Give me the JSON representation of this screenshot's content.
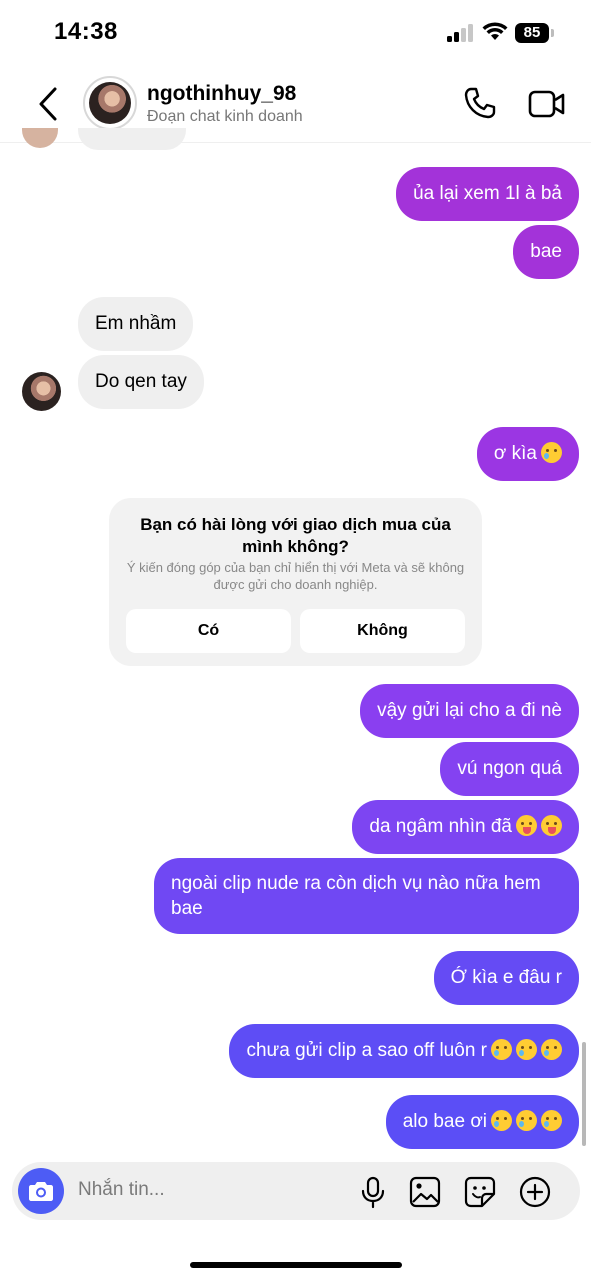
{
  "status_bar": {
    "time": "14:38",
    "battery": "85"
  },
  "header": {
    "username": "ngothinhuy_98",
    "subtitle": "Đoạn chat kinh doanh",
    "icons": [
      "chevron-left-icon",
      "phone-icon",
      "video-icon"
    ]
  },
  "messages": [
    {
      "from": "me",
      "text": "ủa lại xem  1l à bả"
    },
    {
      "from": "me",
      "text": "bae"
    },
    {
      "from": "them",
      "text": "Em nhầm"
    },
    {
      "from": "them",
      "text": "Do qen tay"
    },
    {
      "from": "me",
      "text": "ơ kìa",
      "emoji": [
        "face-holding-back-tears"
      ]
    },
    {
      "from": "me",
      "text": "vậy gửi lại cho a đi nè"
    },
    {
      "from": "me",
      "text": "vú ngon quá"
    },
    {
      "from": "me",
      "text": "da ngâm nhìn đã",
      "emoji": [
        "face-with-tongue",
        "face-with-tongue"
      ]
    },
    {
      "from": "me",
      "text": "ngoài clip nude ra còn dịch vụ nào nữa hem bae"
    },
    {
      "from": "me",
      "text": "Ớ kìa e đâu r"
    },
    {
      "from": "me",
      "text": "chưa gửi clip a sao off luôn r",
      "emoji": [
        "face-holding-back-tears",
        "face-holding-back-tears",
        "face-holding-back-tears"
      ]
    },
    {
      "from": "me",
      "text": "alo bae ơi",
      "emoji": [
        "face-holding-back-tears",
        "face-holding-back-tears",
        "face-holding-back-tears"
      ]
    }
  ],
  "survey": {
    "title": "Bạn có hài lòng với giao dịch mua của mình không?",
    "note": "Ý kiến đóng góp của bạn chỉ hiển thị với Meta và sẽ không được gửi cho doanh nghiệp.",
    "yes_label": "Có",
    "no_label": "Không"
  },
  "composer": {
    "placeholder": "Nhắn tin...",
    "icons": [
      "camera-icon",
      "microphone-icon",
      "image-icon",
      "sticker-icon",
      "plus-circle-icon"
    ]
  },
  "colors": {
    "bubble_purple_top": "#a333d9",
    "bubble_purple_mid": "#8d3ef0",
    "bubble_indigo_bottom": "#5b4ef6",
    "incoming_bg": "#efefef",
    "camera_button": "#4d5cf5"
  }
}
